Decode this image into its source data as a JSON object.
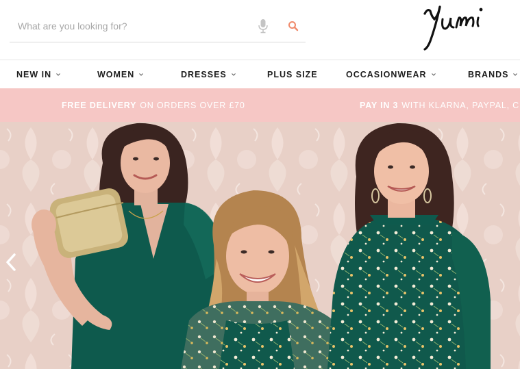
{
  "search": {
    "placeholder": "What are you looking for?",
    "mic_icon": "microphone-icon",
    "search_icon": "search-icon"
  },
  "logo": {
    "text": "Yumi"
  },
  "nav": {
    "items": [
      {
        "label": "NEW IN",
        "has_dropdown": true
      },
      {
        "label": "WOMEN",
        "has_dropdown": true
      },
      {
        "label": "DRESSES",
        "has_dropdown": true
      },
      {
        "label": "PLUS SIZE",
        "has_dropdown": false
      },
      {
        "label": "OCCASIONWEAR",
        "has_dropdown": true
      },
      {
        "label": "BRANDS",
        "has_dropdown": true
      }
    ]
  },
  "promo": {
    "messages": [
      {
        "bold": "FREE DELIVERY",
        "rest": "ON ORDERS OVER £70"
      },
      {
        "bold": "PAY IN 3",
        "rest": "WITH KLARNA, PAYPAL, CLE"
      }
    ]
  },
  "hero": {
    "prev_icon": "chevron-left-icon"
  },
  "colors": {
    "promo_bg": "#f6c7c5",
    "search_accent": "#f08a6b",
    "nav_text": "#1d1d1d",
    "dress_green": "#0e5a4d"
  }
}
